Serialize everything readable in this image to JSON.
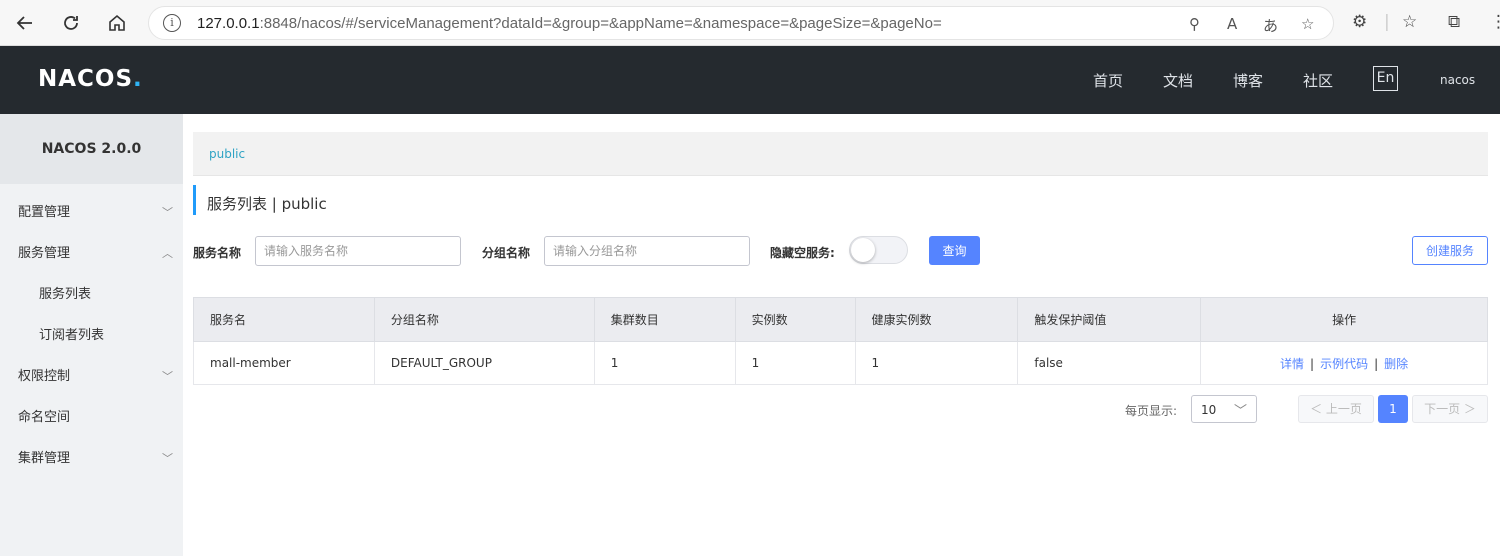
{
  "browser": {
    "url_host": "127.0.0.1",
    "url_rest": ":8848/nacos/#/serviceManagement?dataId=&group=&appName=&namespace=&pageSize=&pageNo="
  },
  "header": {
    "logo": "NACOS",
    "logo_dot": ".",
    "nav": [
      "首页",
      "文档",
      "博客",
      "社区"
    ],
    "lang": "En",
    "user": "nacos"
  },
  "sidebar": {
    "title": "NACOS 2.0.0",
    "items": [
      {
        "label": "配置管理",
        "chevron": "﹀"
      },
      {
        "label": "服务管理",
        "chevron": "︿"
      },
      {
        "label": "服务列表",
        "chevron": ""
      },
      {
        "label": "订阅者列表",
        "chevron": ""
      },
      {
        "label": "权限控制",
        "chevron": "﹀"
      },
      {
        "label": "命名空间",
        "chevron": ""
      },
      {
        "label": "集群管理",
        "chevron": "﹀"
      }
    ]
  },
  "main": {
    "namespace_crumb": "public",
    "title": "服务列表  |  public",
    "filters": {
      "service_name_label": "服务名称",
      "service_name_placeholder": "请输入服务名称",
      "group_name_label": "分组名称",
      "group_name_placeholder": "请输入分组名称",
      "hide_empty_label": "隐藏空服务:",
      "query_button": "查询",
      "create_button": "创建服务"
    },
    "table": {
      "headers": [
        "服务名",
        "分组名称",
        "集群数目",
        "实例数",
        "健康实例数",
        "触发保护阈值",
        "操作"
      ],
      "rows": [
        {
          "cells": [
            "mall-member",
            "DEFAULT_GROUP",
            "1",
            "1",
            "1",
            "false"
          ],
          "ops": [
            "详情",
            "示例代码",
            "删除"
          ],
          "sep": "|"
        }
      ]
    },
    "pagination": {
      "per_page_label": "每页显示:",
      "per_page_value": "10",
      "prev": "＜ 上一页",
      "current": "1",
      "next": "下一页 ＞"
    }
  },
  "colors": {
    "header_bg": "#252a2f",
    "primary": "#5584ff",
    "crumb_text": "#2fa3c4"
  }
}
